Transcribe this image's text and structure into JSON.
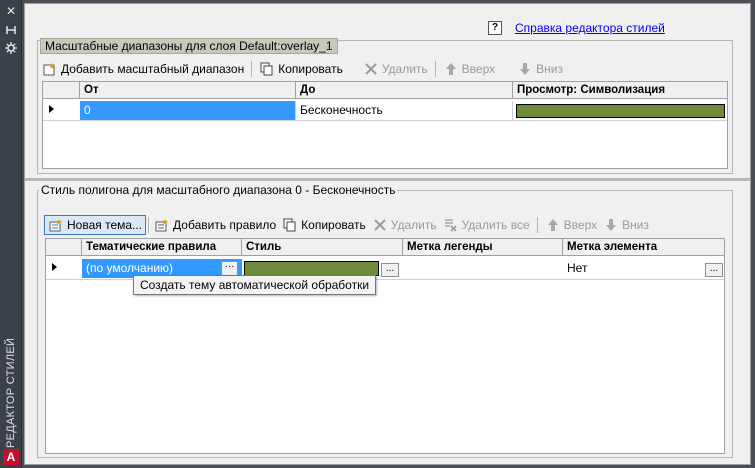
{
  "palette": {
    "vertical_title": "РЕДАКТОР СТИЛЕЙ",
    "close_glyph": "✕",
    "logo_glyph": "A"
  },
  "help": {
    "icon": "?",
    "link": "Справка редактора стилей"
  },
  "scale_ranges": {
    "title": "Масштабные диапазоны для слоя Default:overlay_1",
    "toolbar": {
      "add": "Добавить масштабный диапазон",
      "copy": "Копировать",
      "delete": "Удалить",
      "up": "Вверх",
      "down": "Вниз"
    },
    "columns": [
      "От",
      "До",
      "Просмотр: Символизация"
    ],
    "rows": [
      {
        "from": "0",
        "to": "Бесконечность",
        "swatch_color": "#6e8b3d"
      }
    ]
  },
  "polygon_style": {
    "title": "Стиль полигона для масштабного диапазона 0 - Бесконечность",
    "toolbar": {
      "new_theme": "Новая тема...",
      "add_rule": "Добавить правило",
      "copy": "Копировать",
      "delete": "Удалить",
      "delete_all": "Удалить все",
      "up": "Вверх",
      "down": "Вниз"
    },
    "columns": [
      "Тематические правила",
      "Стиль",
      "Метка легенды",
      "Метка элемента"
    ],
    "rows": [
      {
        "rule": "(по умолчанию)",
        "swatch_color": "#6e8b3d",
        "legend": "",
        "label": "Нет"
      }
    ],
    "tooltip": "Создать тему автоматической обработки"
  },
  "colors": {
    "accent_selection": "#3399ff",
    "swatch_green": "#6e8b3d",
    "link": "#0000ee"
  }
}
